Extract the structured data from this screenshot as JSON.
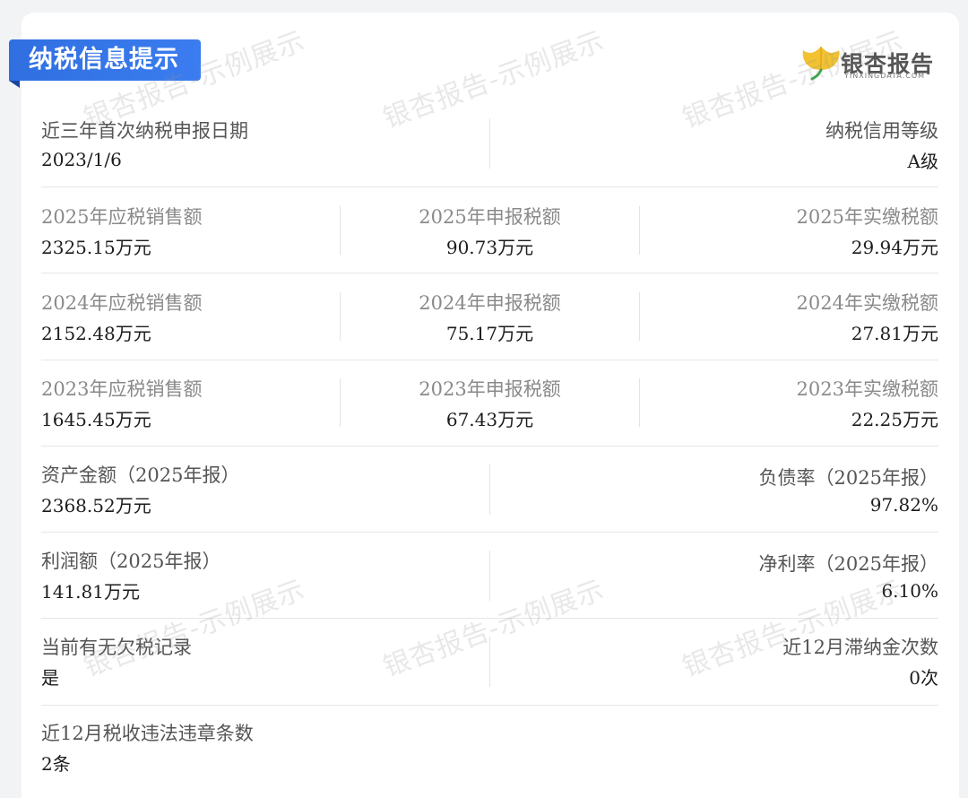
{
  "header": {
    "title": "纳税信息提示",
    "logo_name": "银杏报告",
    "logo_sub": "YINXINGDATA.COM",
    "accent": "#2f6fe0"
  },
  "watermark": "银杏报告-示例展示",
  "rows": {
    "r1": {
      "a_label": "近三年首次纳税申报日期",
      "a_value": "2023/1/6",
      "b_label": "纳税信用等级",
      "b_value": "A级"
    },
    "r2": {
      "a_label": "2025年应税销售额",
      "a_value": "2325.15万元",
      "b_label": "2025年申报税额",
      "b_value": "90.73万元",
      "c_label": "2025年实缴税额",
      "c_value": "29.94万元"
    },
    "r3": {
      "a_label": "2024年应税销售额",
      "a_value": "2152.48万元",
      "b_label": "2024年申报税额",
      "b_value": "75.17万元",
      "c_label": "2024年实缴税额",
      "c_value": "27.81万元"
    },
    "r4": {
      "a_label": "2023年应税销售额",
      "a_value": "1645.45万元",
      "b_label": "2023年申报税额",
      "b_value": "67.43万元",
      "c_label": "2023年实缴税额",
      "c_value": "22.25万元"
    },
    "r5": {
      "a_label": "资产金额（2025年报）",
      "a_value": "2368.52万元",
      "b_label": "负债率（2025年报）",
      "b_value": "97.82%"
    },
    "r6": {
      "a_label": "利润额（2025年报）",
      "a_value": "141.81万元",
      "b_label": "净利率（2025年报）",
      "b_value": "6.10%"
    },
    "r7": {
      "a_label": "当前有无欠税记录",
      "a_value": "是",
      "b_label": "近12月滞纳金次数",
      "b_value": "0次"
    },
    "r8": {
      "a_label": "近12月税收违法违章条数",
      "a_value": "2条"
    }
  }
}
